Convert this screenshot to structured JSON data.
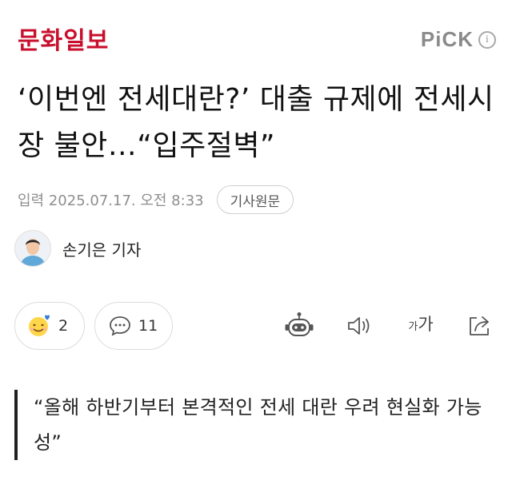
{
  "header": {
    "logo": "문화일보",
    "pick_label": "PiCK",
    "info_glyph": "i"
  },
  "article": {
    "headline": "‘이번엔 전세대란?’ 대출 규제에 전세시장 불안…“입주절벽”",
    "date": "입력 2025.07.17. 오전 8:33",
    "original_button": "기사원문",
    "reporter": "손기은 기자",
    "quote": "“올해 하반기부터 본격적인 전세 대란 우려 현실화 가능성”"
  },
  "actions": {
    "reaction_count": "2",
    "comment_count": "11",
    "font_size_label_small": "가",
    "font_size_label_big": "가"
  },
  "icons": {
    "reaction": "smile-emoji-icon",
    "comment": "speech-bubble-icon",
    "tts": "robot-icon",
    "audio": "speaker-icon",
    "share": "share-icon",
    "info": "info-icon"
  },
  "colors": {
    "logo": "#c8102e",
    "pick": "#8a8a8a",
    "meta": "#8e8e8e",
    "border": "#dcdcdc"
  }
}
